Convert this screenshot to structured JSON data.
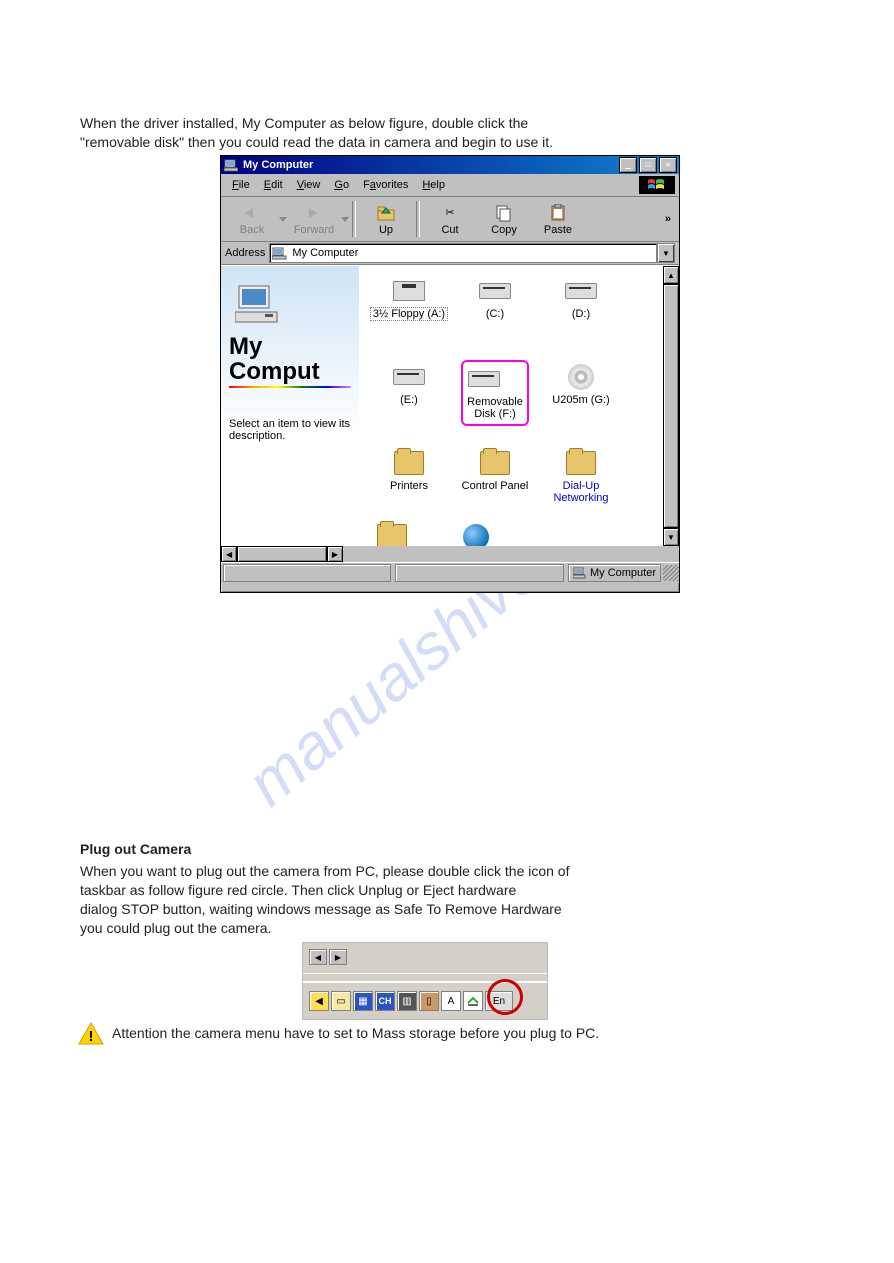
{
  "doc": {
    "intro_line1": "When the driver installed, My Computer as below figure, double click the",
    "intro_line2": "\"removable disk\" then you could read the data in camera and begin to use it.",
    "plug_heading": "Plug out Camera",
    "plug_body1": "When you want to plug out the camera from PC, please double click the icon of",
    "plug_body2": "taskbar as follow figure red circle. Then click Unplug or Eject hardware",
    "plug_body3": "dialog STOP button, waiting windows message as Safe To Remove Hardware",
    "plug_body4": "you could plug out the camera.",
    "attention": "Attention the camera menu have to set to Mass storage before you plug to PC."
  },
  "win": {
    "title": "My Computer",
    "menus": [
      {
        "u": "F",
        "rest": "ile"
      },
      {
        "u": "E",
        "rest": "dit"
      },
      {
        "u": "V",
        "rest": "iew"
      },
      {
        "u": "G",
        "rest": "o"
      },
      {
        "u": "",
        "rest": "F",
        "u2": "a",
        "rest2": "vorites"
      },
      {
        "u": "H",
        "rest": "elp"
      }
    ],
    "toolbar": {
      "back": "Back",
      "forward": "Forward",
      "up": "Up",
      "cut": "Cut",
      "copy": "Copy",
      "paste": "Paste"
    },
    "address_label": "Address",
    "address_value": "My Computer",
    "left": {
      "heading": "My Comput",
      "desc": "Select an item to view its description."
    },
    "items": [
      {
        "label": "3½ Floppy (A:)",
        "kind": "floppy",
        "focused": true
      },
      {
        "label": "(C:)",
        "kind": "drive"
      },
      {
        "label": "(D:)",
        "kind": "drive"
      },
      {
        "label": "(E:)",
        "kind": "drive"
      },
      {
        "label": "Removable Disk (F:)",
        "kind": "drive",
        "highlighted": true
      },
      {
        "label": "U205m (G:)",
        "kind": "cd"
      },
      {
        "label": "Printers",
        "kind": "folder"
      },
      {
        "label": "Control Panel",
        "kind": "folder"
      },
      {
        "label": "Dial-Up Networking",
        "kind": "folder",
        "link": true
      }
    ],
    "partial_row4": [
      {
        "label": "",
        "kind": "folder"
      },
      {
        "label": "",
        "kind": "globe"
      }
    ],
    "status": "My Computer"
  },
  "watermark": "manualshive.com"
}
